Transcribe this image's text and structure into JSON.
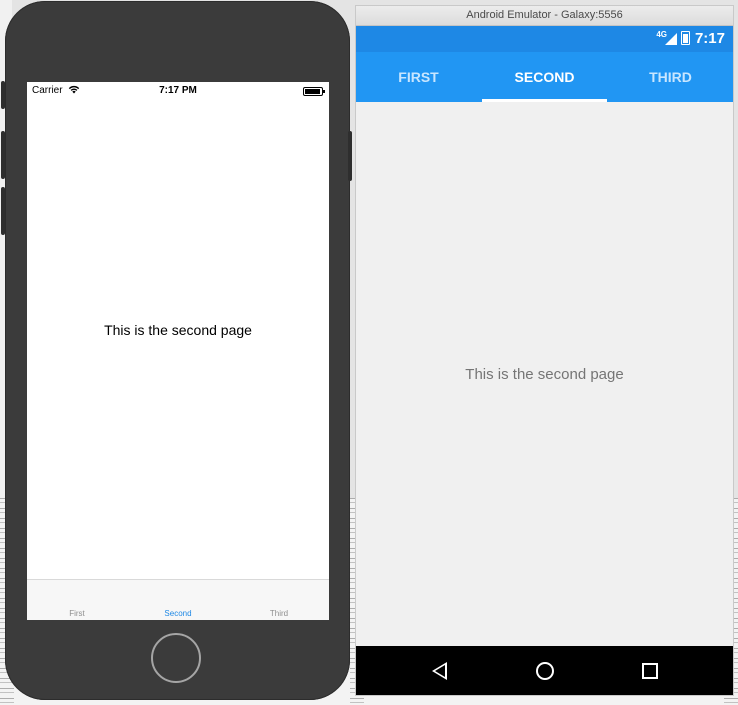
{
  "emulator": {
    "window_title": "Android Emulator - Galaxy:5556"
  },
  "ios": {
    "status": {
      "carrier": "Carrier",
      "time": "7:17 PM"
    },
    "content_text": "This is the second page",
    "tabs": [
      {
        "label": "First",
        "active": false
      },
      {
        "label": "Second",
        "active": true
      },
      {
        "label": "Third",
        "active": false
      }
    ],
    "accent_color": "#1e88e5"
  },
  "android": {
    "status": {
      "network": "4G",
      "time": "7:17"
    },
    "tabs": [
      {
        "label": "FIRST",
        "active": false
      },
      {
        "label": "SECOND",
        "active": true
      },
      {
        "label": "THIRD",
        "active": false
      }
    ],
    "content_text": "This is the second page",
    "primary_color": "#2196f3",
    "status_color": "#1e88e5"
  }
}
